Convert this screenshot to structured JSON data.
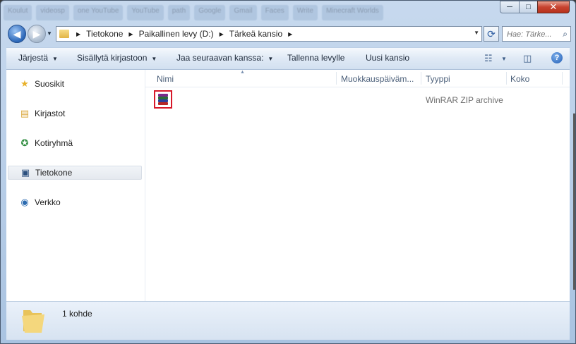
{
  "background_tabs": [
    "Koulut",
    "videosp",
    "one YouTube",
    "YouTube",
    "path",
    "Google",
    "Gmail",
    "Faces",
    "Write",
    "Minecraft Worlds"
  ],
  "window": {
    "minimize": "─",
    "maximize": "□",
    "close": "✕"
  },
  "address": {
    "crumbs": [
      "Tietokone",
      "Paikallinen levy (D:)",
      "Tärkeä kansio"
    ]
  },
  "search": {
    "placeholder": "Hae: Tärke..."
  },
  "toolbar": {
    "organize": "Järjestä",
    "include_library": "Sisällytä kirjastoon",
    "share_with": "Jaa seuraavan kanssa:",
    "burn": "Tallenna levylle",
    "new_folder": "Uusi kansio"
  },
  "nav": {
    "favorites": "Suosikit",
    "libraries": "Kirjastot",
    "homegroup": "Kotiryhmä",
    "computer": "Tietokone",
    "network": "Verkko"
  },
  "columns": {
    "name": "Nimi",
    "modified": "Muokkauspäiväm...",
    "type": "Tyyppi",
    "size": "Koko"
  },
  "files": [
    {
      "name": "",
      "type": "WinRAR ZIP archive",
      "icon": "winrar-icon"
    }
  ],
  "status": {
    "count_text": "1 kohde"
  },
  "colors": {
    "selection_outline": "#d7192a",
    "window_frame": "#a9c3e1"
  }
}
